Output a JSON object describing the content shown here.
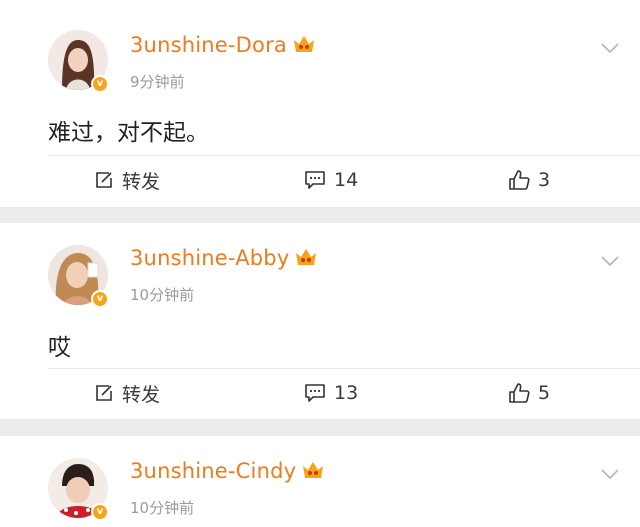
{
  "comments": [
    {
      "username": "3unshine-Dora",
      "time": "9分钟前",
      "text": "难过，对不起。",
      "repost_label": "转发",
      "comment_count": "14",
      "like_count": "3"
    },
    {
      "username": "3unshine-Abby",
      "time": "10分钟前",
      "text": "哎",
      "repost_label": "转发",
      "comment_count": "13",
      "like_count": "5"
    },
    {
      "username": "3unshine-Cindy",
      "time": "10分钟前"
    }
  ],
  "colors": {
    "username": "#ef7b1d",
    "verified_badge": "#f7a516",
    "background": "#ececec"
  },
  "icons": {
    "repost": "edit-square-icon",
    "comment": "comment-bubble-icon",
    "like": "thumbs-up-icon",
    "more": "chevron-down-icon",
    "vip": "vip-crown-icon",
    "verified": "verified-badge-icon"
  }
}
